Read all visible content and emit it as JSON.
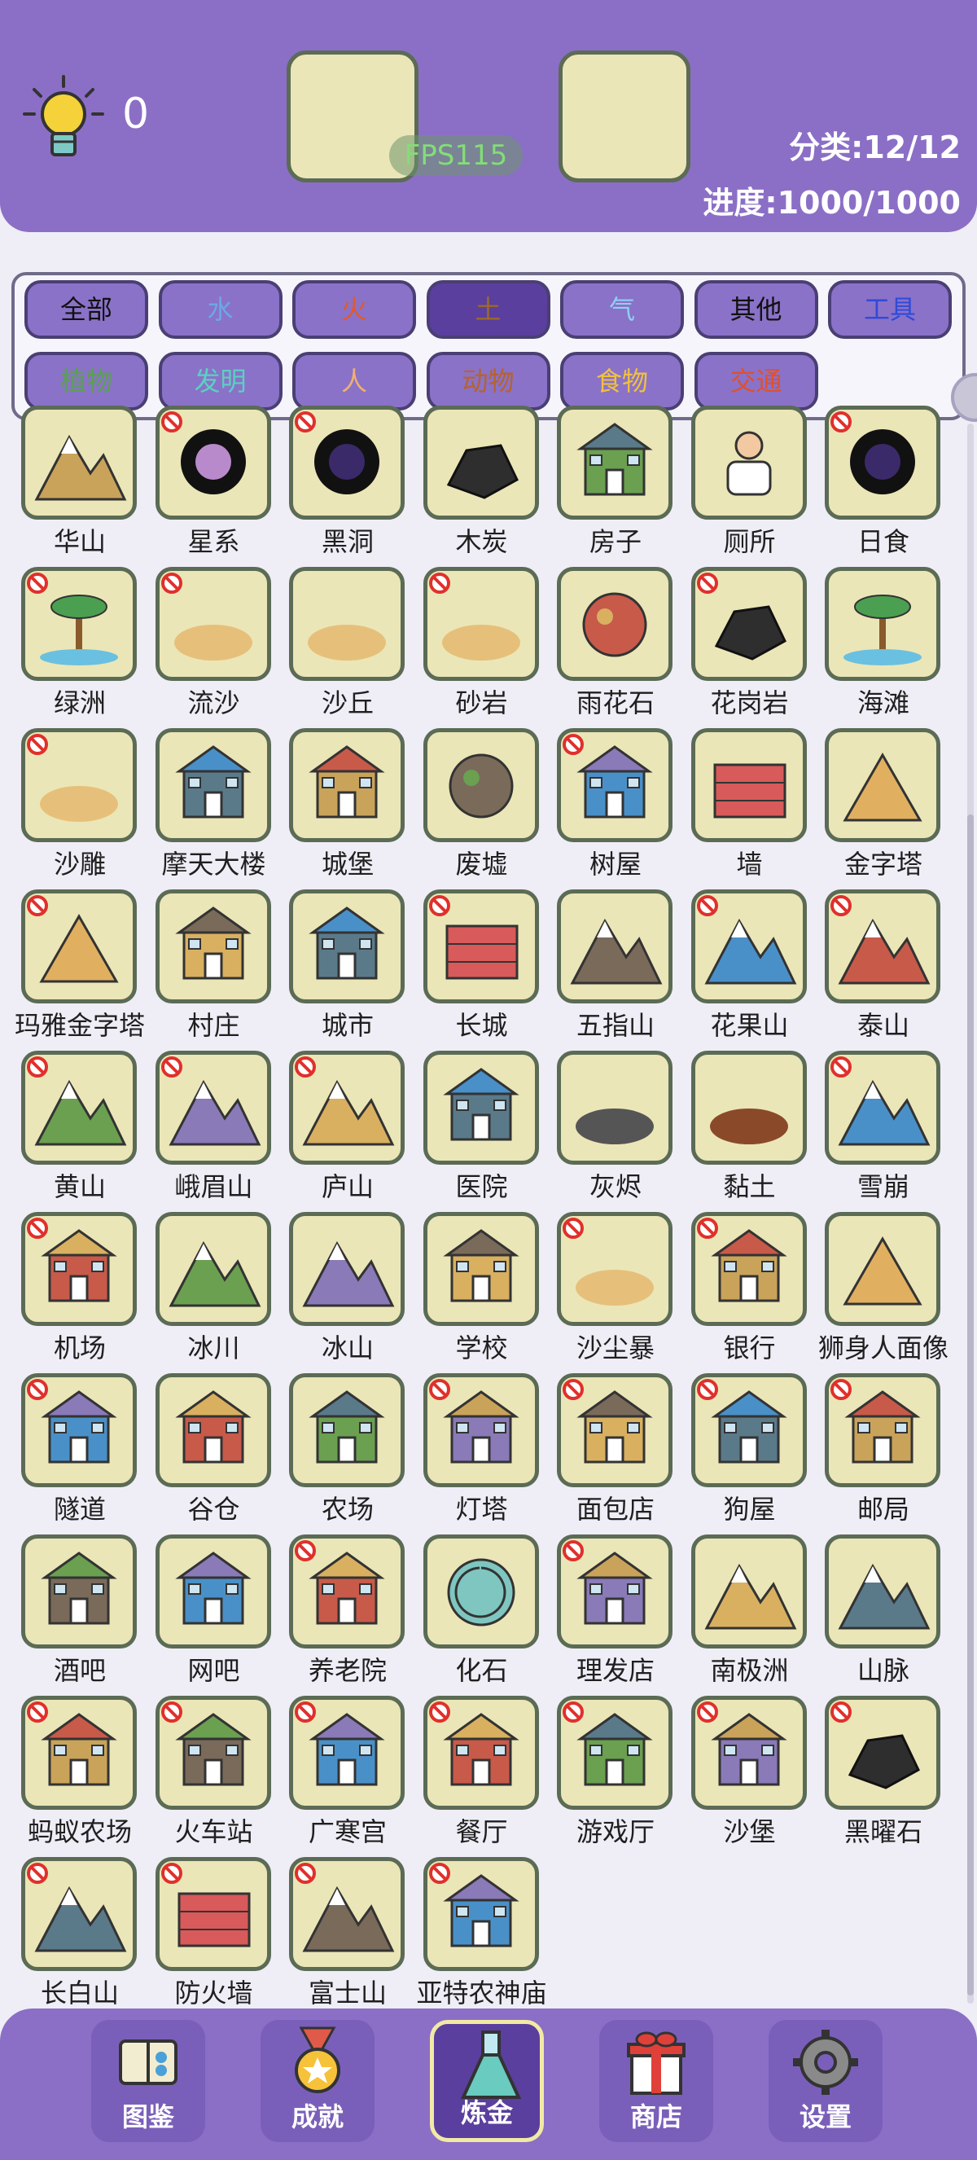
{
  "header": {
    "score": "0",
    "fps": "FPS115",
    "category_stat": "分类:12/12",
    "progress_stat": "进度:1000/1000"
  },
  "categories": [
    {
      "label": "全部",
      "color": "#111111",
      "selected": false
    },
    {
      "label": "水",
      "color": "#6aa8e6",
      "selected": false
    },
    {
      "label": "火",
      "color": "#e05a2c",
      "selected": false
    },
    {
      "label": "土",
      "color": "#9b6a2a",
      "selected": true
    },
    {
      "label": "气",
      "color": "#8fd0f0",
      "selected": false
    },
    {
      "label": "其他",
      "color": "#111111",
      "selected": false
    },
    {
      "label": "工具",
      "color": "#2f4ad8",
      "selected": false
    },
    {
      "label": "植物",
      "color": "#5aa050",
      "selected": false
    },
    {
      "label": "发明",
      "color": "#5bd0c0",
      "selected": false
    },
    {
      "label": "人",
      "color": "#f0b070",
      "selected": false
    },
    {
      "label": "动物",
      "color": "#b5632e",
      "selected": false
    },
    {
      "label": "食物",
      "color": "#f0c040",
      "selected": false
    },
    {
      "label": "交通",
      "color": "#e0502c",
      "selected": false
    }
  ],
  "items": [
    {
      "label": "华山",
      "icon": "mountain-rock-icon",
      "banned": false
    },
    {
      "label": "星系",
      "icon": "galaxy-icon",
      "banned": true
    },
    {
      "label": "黑洞",
      "icon": "black-hole-icon",
      "banned": true
    },
    {
      "label": "木炭",
      "icon": "charcoal-icon",
      "banned": false
    },
    {
      "label": "房子",
      "icon": "house-icon",
      "banned": false
    },
    {
      "label": "厕所",
      "icon": "toilet-icon",
      "banned": false
    },
    {
      "label": "日食",
      "icon": "eclipse-icon",
      "banned": true
    },
    {
      "label": "绿洲",
      "icon": "oasis-icon",
      "banned": true
    },
    {
      "label": "流沙",
      "icon": "quicksand-icon",
      "banned": true
    },
    {
      "label": "沙丘",
      "icon": "dune-icon",
      "banned": false
    },
    {
      "label": "砂岩",
      "icon": "sandstone-icon",
      "banned": true
    },
    {
      "label": "雨花石",
      "icon": "pebbles-icon",
      "banned": false
    },
    {
      "label": "花岗岩",
      "icon": "granite-icon",
      "banned": true
    },
    {
      "label": "海滩",
      "icon": "beach-icon",
      "banned": false
    },
    {
      "label": "沙雕",
      "icon": "sand-sculpture-icon",
      "banned": true
    },
    {
      "label": "摩天大楼",
      "icon": "skyscraper-icon",
      "banned": false
    },
    {
      "label": "城堡",
      "icon": "castle-icon",
      "banned": false
    },
    {
      "label": "废墟",
      "icon": "ruins-icon",
      "banned": false
    },
    {
      "label": "树屋",
      "icon": "treehouse-icon",
      "banned": true
    },
    {
      "label": "墙",
      "icon": "wall-icon",
      "banned": false
    },
    {
      "label": "金字塔",
      "icon": "pyramid-icon",
      "banned": false
    },
    {
      "label": "玛雅金字塔",
      "icon": "maya-pyramid-icon",
      "banned": true
    },
    {
      "label": "村庄",
      "icon": "village-icon",
      "banned": false
    },
    {
      "label": "城市",
      "icon": "city-icon",
      "banned": false
    },
    {
      "label": "长城",
      "icon": "great-wall-icon",
      "banned": true
    },
    {
      "label": "五指山",
      "icon": "five-finger-mountain-icon",
      "banned": false
    },
    {
      "label": "花果山",
      "icon": "flower-fruit-mountain-icon",
      "banned": true
    },
    {
      "label": "泰山",
      "icon": "mount-tai-icon",
      "banned": true
    },
    {
      "label": "黄山",
      "icon": "huangshan-icon",
      "banned": true
    },
    {
      "label": "峨眉山",
      "icon": "emei-icon",
      "banned": true
    },
    {
      "label": "庐山",
      "icon": "lushan-icon",
      "banned": true
    },
    {
      "label": "医院",
      "icon": "hospital-icon",
      "banned": false
    },
    {
      "label": "灰烬",
      "icon": "ash-icon",
      "banned": false
    },
    {
      "label": "黏土",
      "icon": "clay-icon",
      "banned": false
    },
    {
      "label": "雪崩",
      "icon": "avalanche-icon",
      "banned": true
    },
    {
      "label": "机场",
      "icon": "airport-icon",
      "banned": true
    },
    {
      "label": "冰川",
      "icon": "glacier-icon",
      "banned": false
    },
    {
      "label": "冰山",
      "icon": "iceberg-icon",
      "banned": false
    },
    {
      "label": "学校",
      "icon": "school-icon",
      "banned": false
    },
    {
      "label": "沙尘暴",
      "icon": "sandstorm-icon",
      "banned": true
    },
    {
      "label": "银行",
      "icon": "bank-icon",
      "banned": true
    },
    {
      "label": "狮身人面像",
      "icon": "sphinx-icon",
      "banned": false
    },
    {
      "label": "隧道",
      "icon": "tunnel-icon",
      "banned": true
    },
    {
      "label": "谷仓",
      "icon": "barn-icon",
      "banned": false
    },
    {
      "label": "农场",
      "icon": "farm-icon",
      "banned": false
    },
    {
      "label": "灯塔",
      "icon": "lighthouse-icon",
      "banned": true
    },
    {
      "label": "面包店",
      "icon": "bakery-icon",
      "banned": true
    },
    {
      "label": "狗屋",
      "icon": "doghouse-icon",
      "banned": true
    },
    {
      "label": "邮局",
      "icon": "post-office-icon",
      "banned": true
    },
    {
      "label": "酒吧",
      "icon": "bar-icon",
      "banned": false
    },
    {
      "label": "网吧",
      "icon": "internet-cafe-icon",
      "banned": false
    },
    {
      "label": "养老院",
      "icon": "nursing-home-icon",
      "banned": true
    },
    {
      "label": "化石",
      "icon": "fossil-icon",
      "banned": false
    },
    {
      "label": "理发店",
      "icon": "barbershop-icon",
      "banned": true
    },
    {
      "label": "南极洲",
      "icon": "antarctica-icon",
      "banned": false
    },
    {
      "label": "山脉",
      "icon": "mountain-range-icon",
      "banned": false
    },
    {
      "label": "蚂蚁农场",
      "icon": "ant-farm-icon",
      "banned": true
    },
    {
      "label": "火车站",
      "icon": "train-station-icon",
      "banned": true
    },
    {
      "label": "广寒宫",
      "icon": "moon-palace-icon",
      "banned": true
    },
    {
      "label": "餐厅",
      "icon": "restaurant-icon",
      "banned": true
    },
    {
      "label": "游戏厅",
      "icon": "arcade-icon",
      "banned": true
    },
    {
      "label": "沙堡",
      "icon": "sandcastle-icon",
      "banned": true
    },
    {
      "label": "黑曜石",
      "icon": "obsidian-icon",
      "banned": true
    },
    {
      "label": "长白山",
      "icon": "changbai-icon",
      "banned": true
    },
    {
      "label": "防火墙",
      "icon": "firewall-icon",
      "banned": true
    },
    {
      "label": "富士山",
      "icon": "fuji-icon",
      "banned": true
    },
    {
      "label": "亚特农神庙",
      "icon": "parthenon-icon",
      "banned": true
    }
  ],
  "nav": [
    {
      "label": "图鉴",
      "icon": "book-icon",
      "active": false
    },
    {
      "label": "成就",
      "icon": "medal-icon",
      "active": false
    },
    {
      "label": "炼金",
      "icon": "flask-icon",
      "active": true
    },
    {
      "label": "商店",
      "icon": "gift-icon",
      "active": false
    },
    {
      "label": "设置",
      "icon": "gear-icon",
      "active": false
    }
  ]
}
